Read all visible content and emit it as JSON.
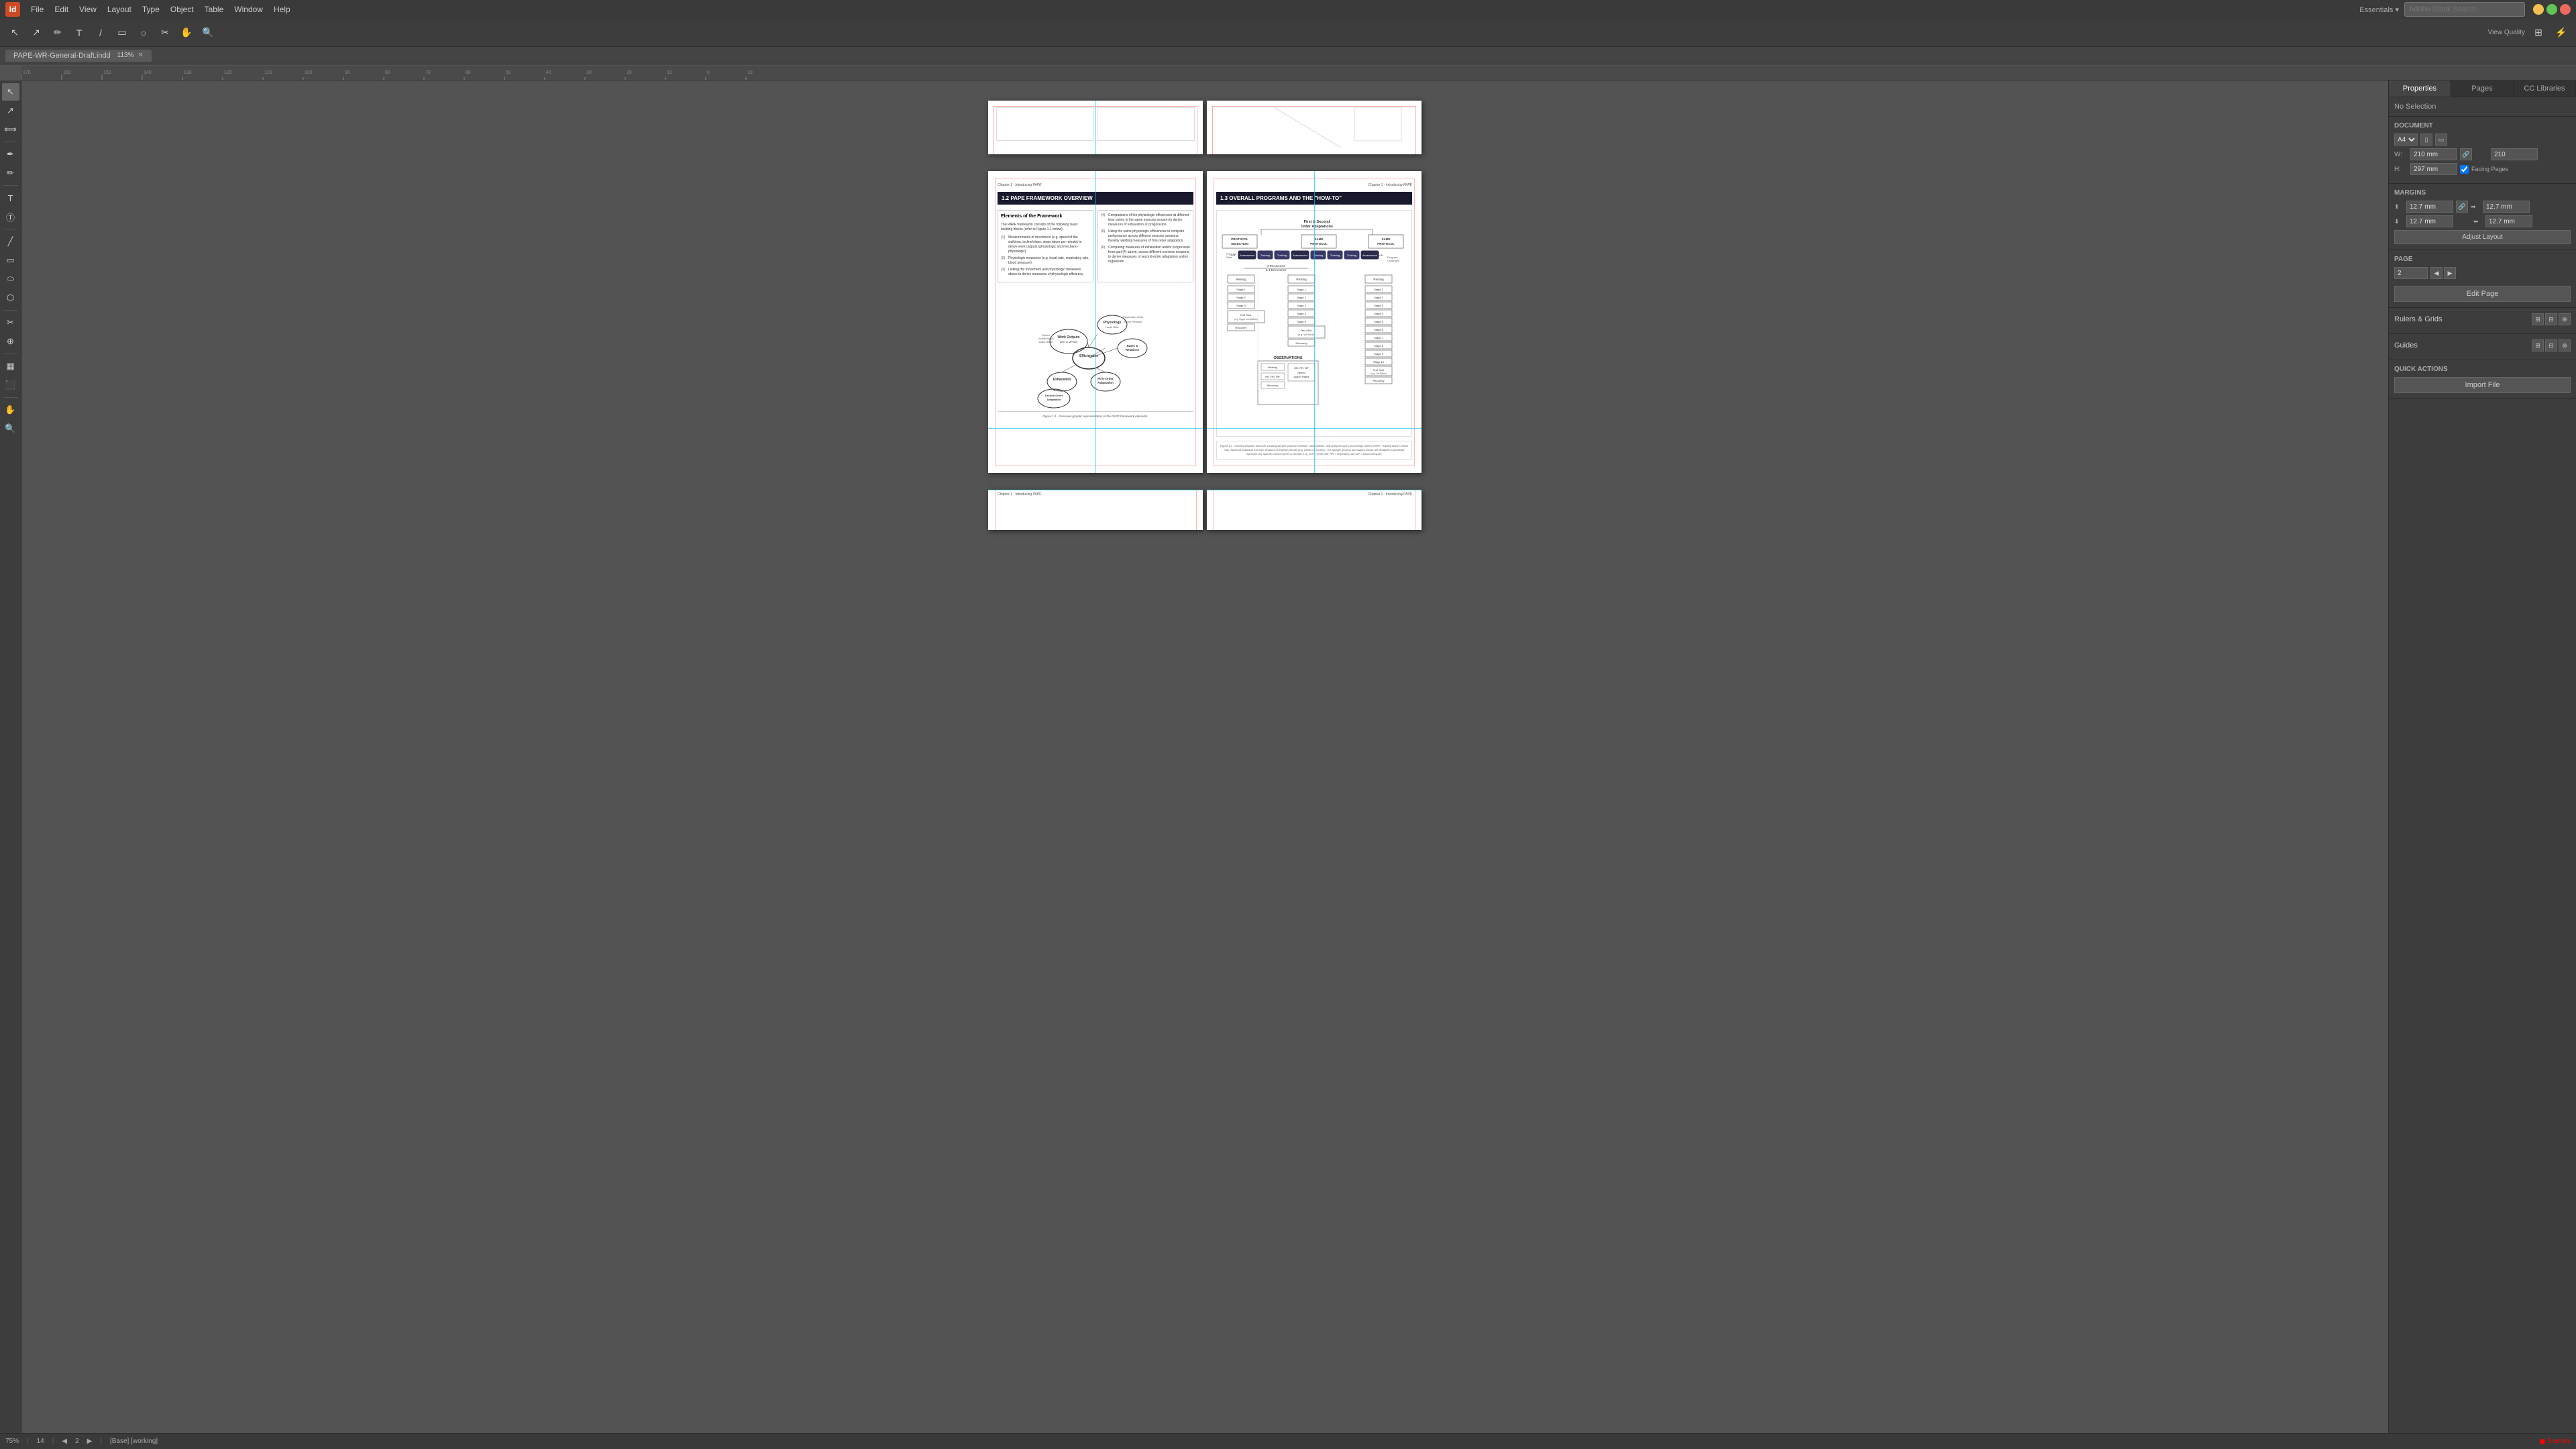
{
  "app": {
    "title": "Adobe InDesign",
    "icon": "Id"
  },
  "menu": {
    "items": [
      "File",
      "Edit",
      "View",
      "Layout",
      "Type",
      "Object",
      "Table",
      "View",
      "Window",
      "Help"
    ]
  },
  "toolbar": {
    "search_placeholder": "Adobe Stock Search"
  },
  "tab": {
    "filename": "PAPE-WR-General-Draft.indd",
    "zoom": "113%"
  },
  "right_panel": {
    "tabs": [
      "Properties",
      "Pages",
      "CC Libraries"
    ],
    "active_tab": "Properties",
    "no_selection": "No Selection",
    "document_section": {
      "title": "Document",
      "size": "A4",
      "width": "210 mm",
      "height": "297 mm",
      "facing_pages": true
    },
    "margins_section": {
      "title": "Margins",
      "top": "12.7 mm",
      "bottom": "12.7 mm",
      "left": "12.7 mm",
      "right": "12.7 mm"
    },
    "adjust_layout_btn": "Adjust Layout",
    "page_section": {
      "title": "Page",
      "page_number": "2",
      "edit_page_btn": "Edit Page"
    },
    "rulers_grids_section": "Rulers & Grids",
    "guides_section": "Guides",
    "quick_actions_section": "Quick Actions",
    "import_file_btn": "Import File"
  },
  "pages": {
    "spread1_partial": {
      "chapter_left": "",
      "chapter_right": ""
    },
    "spread2": {
      "left_page": {
        "chapter": "Chapter 1 - Introducing PAPE",
        "section_title": "1.2 PAPE FRAMEWORK OVERVIEW",
        "elements_title": "Elements of the Framework",
        "intro_text": "The PAPE framework consists of the following basic building blocks (refer to Figure 1.1 below):",
        "items": [
          {
            "num": "(1)",
            "text": "Measurements of movement (e.g. speed of the walk/run, incline/slope, steps taken per minute) to derive work outputs (physiologic and mechano-physiologic)."
          },
          {
            "num": "(2)",
            "text": "Physiologic measures (e.g. heart rate, respiratory rate, blood pressure)."
          },
          {
            "num": "(3)",
            "text": "Linking the movement and physiologic measures above to derive measures of physiologic efficiency."
          }
        ],
        "items2": [
          {
            "num": "(4)",
            "text": "Comparisons of the physiologic efficiencies at different time points in the same exercise session to derive measures of exhaustion or progression."
          },
          {
            "num": "(5)",
            "text": "Using the same physiologic efficiencies to compare performance across different exercise sessions, thereby yielding measures of first-order adaptation."
          },
          {
            "num": "(6)",
            "text": "Comparing measures of exhaustion and/or progression from part (4) above, across different exercise sessions, to derive measures of second-order adaptation and/or regression."
          }
        ],
        "figure_caption": "Figure 1.1 - Overview graphic representation of the PAPE framework elements."
      },
      "right_page": {
        "chapter": "Chapter 1 - Introducing PAPE",
        "section_title": "1.3 OVERALL PROGRAMS AND THE \"HOW-TO\"",
        "figure_caption": "Figure 1.2 - General program structure showing sample protocol selection, observations, and analyses types and timings used in PAPE. Training blocks shown may represent individual exercise sessions or training periods (e.g. weeks or months). The sample protocol and stages shown are designed to generally represent any specific protocol (refer to Section 1.4). (HR = heart rate; RR = respiratory rate; BP = blood pressure).",
        "diagram_labels": {
          "first_second_order": "First & Second Order Adaptations",
          "protocol_selection": "PROTOCOL SELECTION",
          "same_protocol": "SAME PROTOCOL",
          "same_protocol2": "SAME PROTOCOL",
          "assessment": "Assessment",
          "training": "Training",
          "program_start": "Program Start",
          "program_continues": "Program Continues",
          "observations": "OBSERVATIONS",
          "resting": "Resting",
          "test_shot": "Test Shot",
          "recovery": "Recovery",
          "action_rates": "Action Rates",
          "hr_rr_bp": "HR, RR, BP"
        }
      }
    }
  },
  "status_bar": {
    "zoom": "75%",
    "page_info": "14",
    "page_current": "2",
    "state": "[Base] [working]",
    "errors": "5 errors"
  }
}
